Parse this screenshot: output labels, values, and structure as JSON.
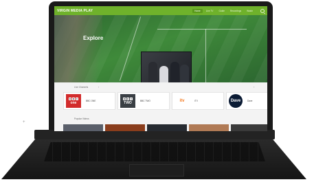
{
  "app": {
    "brand": "VIRGIN MEDIA PLAY"
  },
  "nav": {
    "links": [
      "Home",
      "Live TV",
      "Guide",
      "Recordings",
      "Watch"
    ],
    "active_index": 0,
    "search_icon": "search-icon"
  },
  "hero": {
    "title": "Explore",
    "card_caption": ""
  },
  "channels": {
    "section_title": "Live Channels",
    "items": [
      {
        "name": "BBC ONE",
        "logo_text": "one",
        "bbc": true,
        "logo_bg": "#d22c2c",
        "logo_color": "#ffffff"
      },
      {
        "name": "BBC TWO",
        "logo_text": "TWO",
        "bbc": true,
        "logo_bg": "#3a3f44",
        "logo_color": "#ffffff"
      },
      {
        "name": "ITV",
        "logo_text": "itv",
        "bbc": false,
        "logo_bg": "#ffffff",
        "logo_color": "#f47a20"
      },
      {
        "name": "Dave",
        "logo_text": "Dave",
        "bbc": false,
        "logo_bg": "#0b1b34",
        "logo_color": "#ffffff"
      }
    ]
  },
  "videos": {
    "section_title": "Popular Videos",
    "thumb_colors": [
      "#5a5f6a",
      "#8a3d1c",
      "#262a30",
      "#b07a55",
      "#3a3a3a"
    ]
  },
  "colors": {
    "accent": "#6fb22b",
    "laptop": "#1a1a1a"
  }
}
